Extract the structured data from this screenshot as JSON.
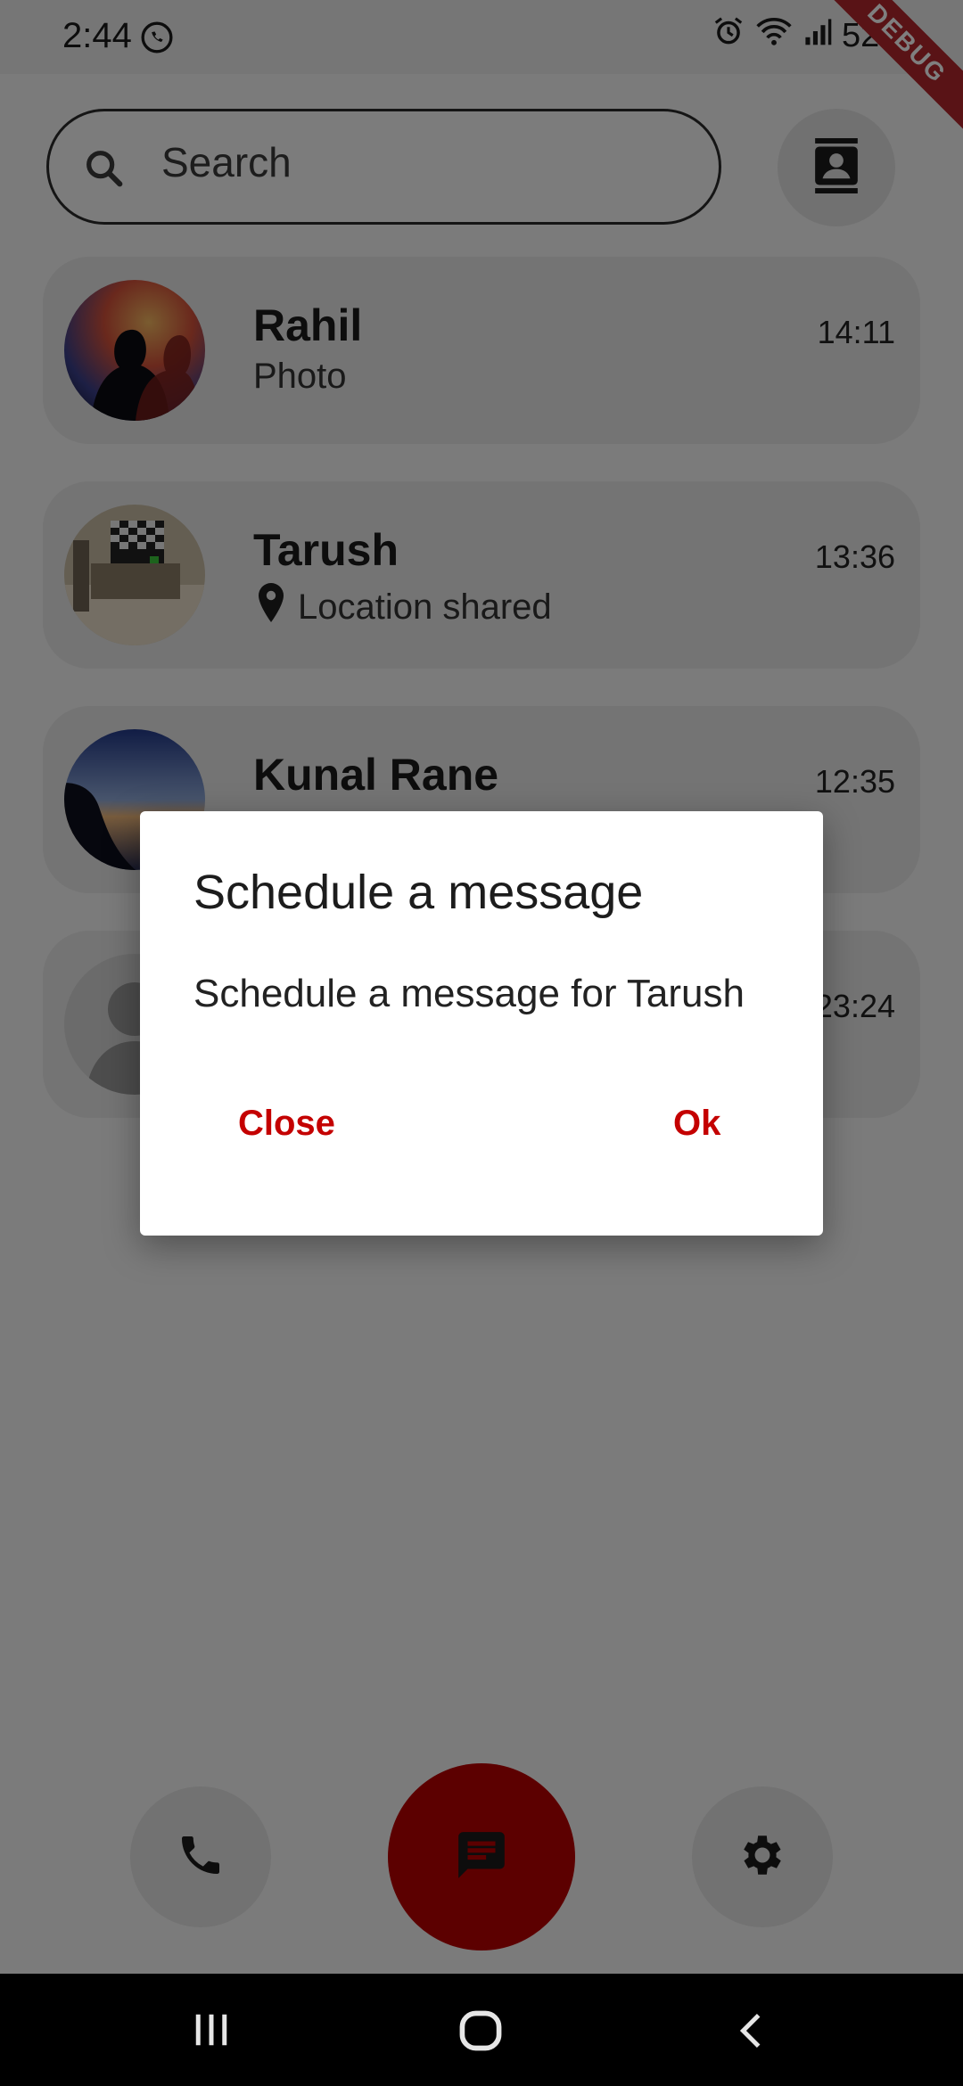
{
  "status_bar": {
    "time": "2:44",
    "battery": "52%",
    "debug_label": "DEBUG"
  },
  "search": {
    "placeholder": "Search"
  },
  "chats": [
    {
      "name": "Rahil",
      "preview": "Photo",
      "time": "14:11"
    },
    {
      "name": "Tarush",
      "preview": "Location shared",
      "time": "13:36"
    },
    {
      "name": "Kunal Rane",
      "preview": "",
      "time": "12:35"
    },
    {
      "name": "",
      "preview": "",
      "time": "23:24"
    }
  ],
  "dialog": {
    "title": "Schedule a message",
    "body": "Schedule a message for Tarush",
    "close_label": "Close",
    "ok_label": "Ok"
  },
  "colors": {
    "accent": "#b90000",
    "dialog_button": "#c40000",
    "scrim": "rgba(0,0,0,0.5)"
  },
  "icons": [
    "whatsapp-icon",
    "alarm-icon",
    "wifi-icon",
    "signal-icon",
    "battery-icon",
    "search-icon",
    "contacts-icon",
    "location-pin-icon",
    "phone-icon",
    "chat-icon",
    "settings-icon",
    "recents-icon",
    "home-icon",
    "back-icon"
  ]
}
